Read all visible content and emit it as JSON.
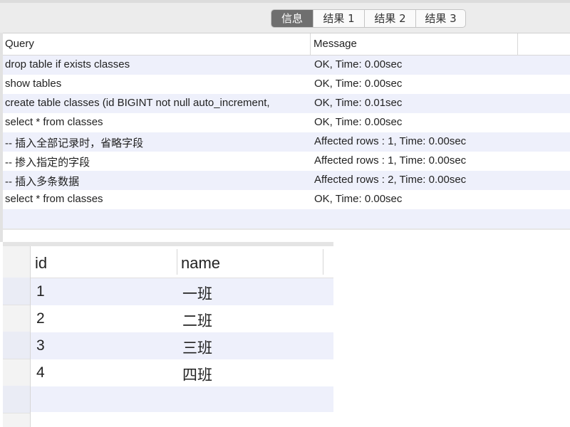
{
  "tabs": [
    {
      "label": "信息",
      "active": true
    },
    {
      "label": "结果 1",
      "active": false
    },
    {
      "label": "结果 2",
      "active": false
    },
    {
      "label": "结果 3",
      "active": false
    }
  ],
  "messages": {
    "columns": {
      "query": "Query",
      "message": "Message"
    },
    "rows": [
      {
        "query": "drop table if exists classes",
        "message": "OK, Time: 0.00sec"
      },
      {
        "query": "show tables",
        "message": "OK, Time: 0.00sec"
      },
      {
        "query": "create table classes (id BIGINT not null auto_increment,",
        "message": "OK, Time: 0.01sec"
      },
      {
        "query": "select * from classes",
        "message": "OK, Time: 0.00sec"
      },
      {
        "query": "-- 插入全部记录时，省略字段",
        "message": "Affected rows : 1, Time: 0.00sec"
      },
      {
        "query": "-- 掺入指定的字段",
        "message": "Affected rows : 1, Time: 0.00sec"
      },
      {
        "query": "-- 插入多条数据",
        "message": "Affected rows : 2, Time: 0.00sec"
      },
      {
        "query": "select * from classes",
        "message": "OK, Time: 0.00sec"
      }
    ]
  },
  "result": {
    "columns": {
      "id": "id",
      "name": "name"
    },
    "rows": [
      {
        "id": "1",
        "name": "一班"
      },
      {
        "id": "2",
        "name": "二班"
      },
      {
        "id": "3",
        "name": "三班"
      },
      {
        "id": "4",
        "name": "四班"
      }
    ]
  },
  "colors": {
    "row_alt": "#eef0fb",
    "tab_active": "#6f6f6f"
  }
}
